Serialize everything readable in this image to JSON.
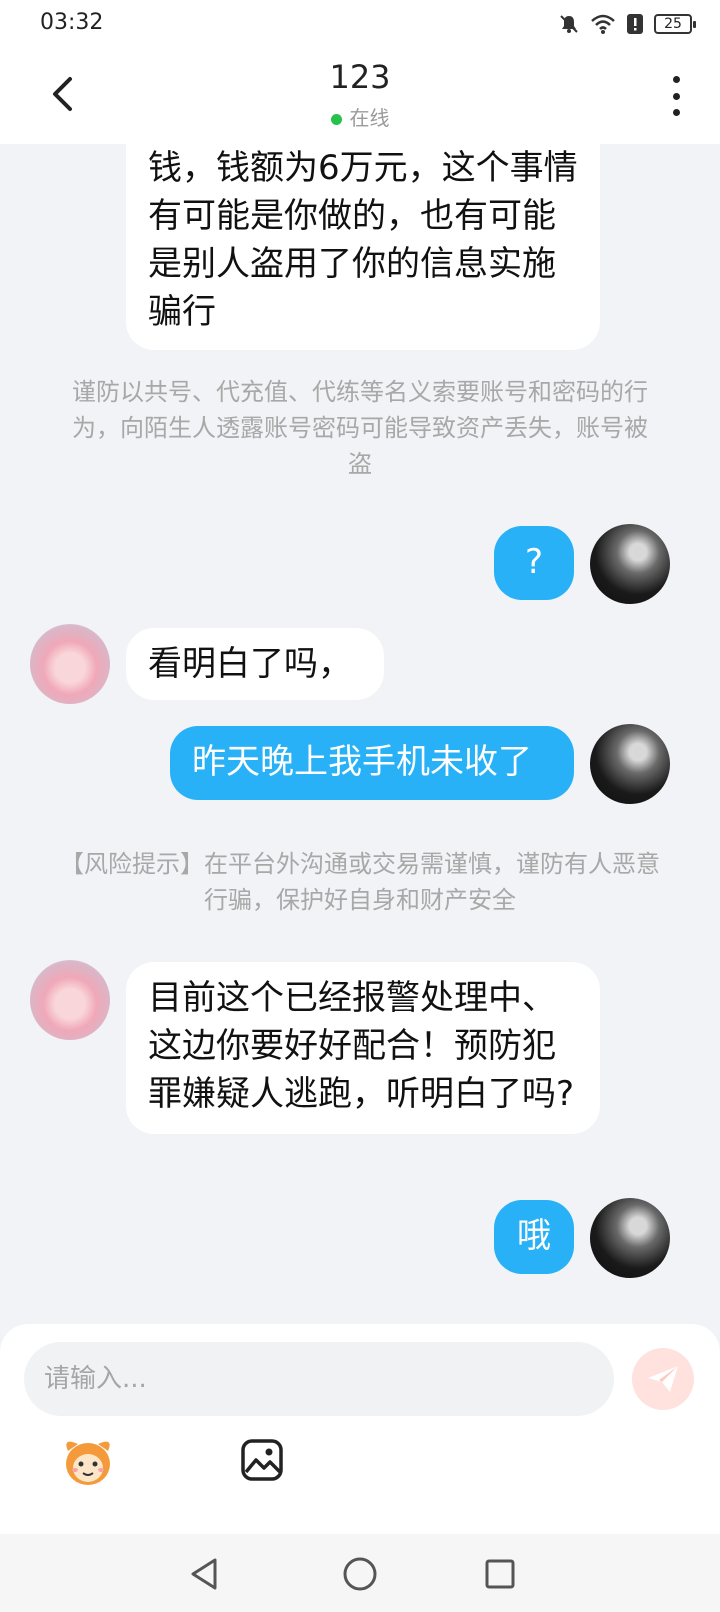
{
  "status_bar": {
    "time": "03:32",
    "battery": "25"
  },
  "header": {
    "title": "123",
    "presence": "在线"
  },
  "messages": [
    {
      "text": "钱，钱额为6万元，这个事情有可能是你做的，也有可能是别人盗用了你的信息实施骗行"
    },
    {
      "text": "谨防以共号、代充值、代练等名义索要账号和密码的行为，向陌生人透露账号密码可能导致资产丢失，账号被盗"
    },
    {
      "text": "?"
    },
    {
      "text": "看明白了吗，"
    },
    {
      "text": "昨天晚上我手机未收了"
    },
    {
      "text": "【风险提示】在平台外沟通或交易需谨慎，谨防有人恶意行骗，保护好自身和财产安全"
    },
    {
      "text": "目前这个已经报警处理中、这边你要好好配合！预防犯罪嫌疑人逃跑，听明白了吗?"
    },
    {
      "text": "哦"
    }
  ],
  "input": {
    "placeholder": "请输入..."
  },
  "icons": {
    "back": "back-chevron-icon",
    "more": "more-vertical-icon",
    "send": "paper-plane-icon",
    "emoji": "emoji-face-icon",
    "image": "image-icon"
  },
  "colors": {
    "accent": "#28b1f6",
    "online": "#27c24c",
    "send_bg": "#ffe1de"
  }
}
